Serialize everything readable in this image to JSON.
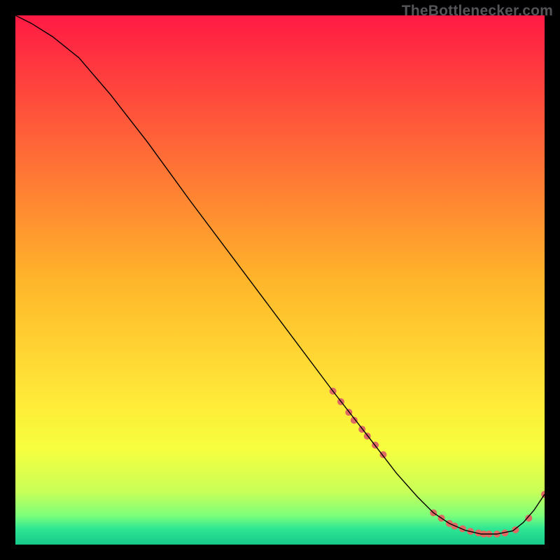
{
  "watermark": "TheBottlenecker.com",
  "chart_data": {
    "type": "line",
    "title": "",
    "xlabel": "",
    "ylabel": "",
    "xlim": [
      0,
      100
    ],
    "ylim": [
      0,
      100
    ],
    "grid": false,
    "legend": false,
    "background_gradient": {
      "stops": [
        {
          "offset": 0.0,
          "color": "#ff1a44"
        },
        {
          "offset": 0.5,
          "color": "#ffb52a"
        },
        {
          "offset": 0.72,
          "color": "#ffe838"
        },
        {
          "offset": 0.82,
          "color": "#f6ff3e"
        },
        {
          "offset": 0.9,
          "color": "#c8ff58"
        },
        {
          "offset": 0.945,
          "color": "#7dff7a"
        },
        {
          "offset": 0.97,
          "color": "#2fe693"
        },
        {
          "offset": 1.0,
          "color": "#16c98a"
        }
      ]
    },
    "series": [
      {
        "name": "curve",
        "color": "#000000",
        "stroke_width": 1.4,
        "x": [
          0,
          3,
          7,
          12,
          18,
          25,
          33,
          42,
          51,
          60,
          67,
          72,
          76,
          79,
          82,
          85,
          88,
          91,
          94,
          96,
          98,
          100
        ],
        "y": [
          100,
          98.5,
          96,
          92,
          85,
          76,
          65,
          53,
          41,
          29,
          20,
          13.5,
          9,
          6,
          4,
          2.7,
          2,
          2,
          2.6,
          4.2,
          6.5,
          9.5
        ]
      }
    ],
    "scatter": [
      {
        "name": "dots",
        "color": "#df6a63",
        "radius": 5,
        "points": [
          {
            "x": 60.0,
            "y": 29.0
          },
          {
            "x": 61.5,
            "y": 27.0
          },
          {
            "x": 63.0,
            "y": 25.0
          },
          {
            "x": 64.0,
            "y": 23.5
          },
          {
            "x": 65.5,
            "y": 21.8
          },
          {
            "x": 66.5,
            "y": 20.5
          },
          {
            "x": 68.0,
            "y": 18.8
          },
          {
            "x": 69.5,
            "y": 17.0
          },
          {
            "x": 79.0,
            "y": 6.0
          },
          {
            "x": 80.5,
            "y": 5.0
          },
          {
            "x": 82.0,
            "y": 4.0
          },
          {
            "x": 83.0,
            "y": 3.5
          },
          {
            "x": 84.5,
            "y": 3.0
          },
          {
            "x": 86.0,
            "y": 2.5
          },
          {
            "x": 87.5,
            "y": 2.2
          },
          {
            "x": 88.5,
            "y": 2.0
          },
          {
            "x": 89.5,
            "y": 2.0
          },
          {
            "x": 91.0,
            "y": 2.0
          },
          {
            "x": 92.5,
            "y": 2.2
          },
          {
            "x": 94.5,
            "y": 2.8
          },
          {
            "x": 97.0,
            "y": 5.0
          },
          {
            "x": 100.0,
            "y": 9.5
          }
        ]
      }
    ]
  }
}
